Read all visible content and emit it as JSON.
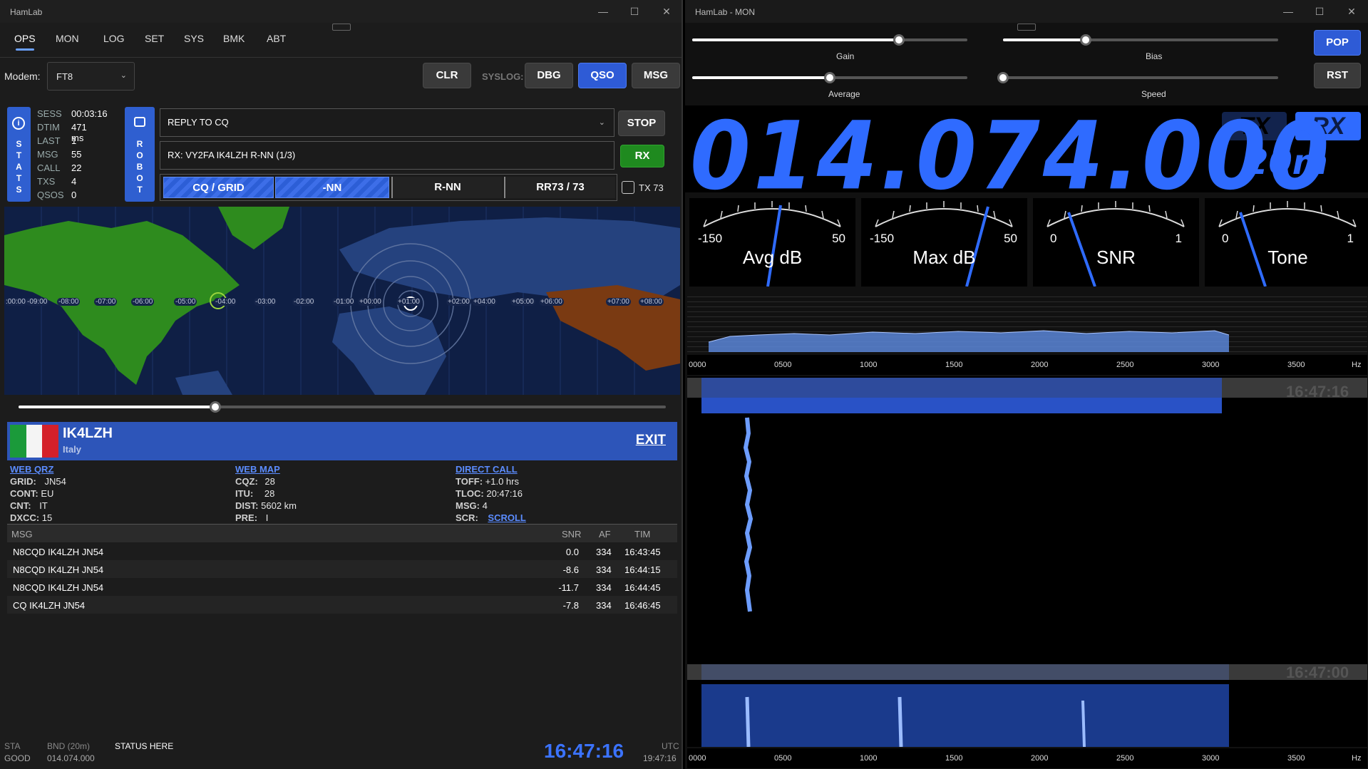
{
  "left": {
    "title": "HamLab",
    "tabs": [
      "OPS",
      "MON",
      "LOG",
      "SET",
      "SYS",
      "BMK",
      "ABT"
    ],
    "modem_label": "Modem:",
    "modem_value": "FT8",
    "buttons": {
      "clr": "CLR",
      "syslog": "SYSLOG:",
      "dbg": "DBG",
      "qso": "QSO",
      "msg": "MSG",
      "stop": "STOP",
      "rx": "RX"
    },
    "stats_side": "STATS",
    "robot_side": "ROBOT",
    "stats": [
      {
        "k": "SESS",
        "v": "00:03:16"
      },
      {
        "k": "DTIM",
        "v": "471 ms"
      },
      {
        "k": "LAST",
        "v": "1"
      },
      {
        "k": "MSG",
        "v": "55"
      },
      {
        "k": "CALL",
        "v": "22"
      },
      {
        "k": "TXS",
        "v": "4"
      },
      {
        "k": "QSOS",
        "v": "0"
      }
    ],
    "reply_select": "REPLY TO CQ",
    "rx_text": "RX: VY2FA IK4LZH R-NN (1/3)",
    "sequence": [
      "CQ / GRID",
      "-NN",
      "R-NN",
      "RR73 / 73"
    ],
    "tx73_label": "TX 73",
    "timezones": [
      ":00:00",
      "-09:00",
      "-08:00",
      "-07:00",
      "-06:00",
      "-05:00",
      "-04:00",
      "-03:00",
      "-02:00",
      "-01:00",
      "+00:00",
      "+01:00",
      "+02:00",
      "+04:00",
      "+05:00",
      "+06:00",
      "+07:00",
      "+08:00"
    ],
    "call": {
      "sign": "IK4LZH",
      "country": "Italy",
      "exit": "EXIT"
    },
    "info": {
      "col1": {
        "link": "WEB QRZ",
        "rows": [
          {
            "k": "GRID:",
            "v": "JN54"
          },
          {
            "k": "CONT:",
            "v": "EU"
          },
          {
            "k": "CNT:",
            "v": "IT"
          },
          {
            "k": "DXCC:",
            "v": "15"
          }
        ]
      },
      "col2": {
        "link": "WEB MAP",
        "rows": [
          {
            "k": "CQZ:",
            "v": "28"
          },
          {
            "k": "ITU:",
            "v": "28"
          },
          {
            "k": "DIST:",
            "v": "5602 km"
          },
          {
            "k": "PRE:",
            "v": "I"
          }
        ]
      },
      "col3": {
        "link": "DIRECT CALL",
        "rows": [
          {
            "k": "TOFF:",
            "v": "+1.0 hrs"
          },
          {
            "k": "TLOC:",
            "v": "20:47:16"
          },
          {
            "k": "MSG:",
            "v": "4"
          }
        ],
        "scr_k": "SCR:",
        "scr_link": "SCROLL"
      }
    },
    "table": {
      "headers": [
        "MSG",
        "SNR",
        "AF",
        "TIM"
      ],
      "rows": [
        [
          "N8CQD IK4LZH JN54",
          "0.0",
          "334",
          "16:43:45"
        ],
        [
          "N8CQD IK4LZH JN54",
          "-8.6",
          "334",
          "16:44:15"
        ],
        [
          "N8CQD IK4LZH JN54",
          "-11.7",
          "334",
          "16:44:45"
        ],
        [
          "CQ IK4LZH JN54",
          "-7.8",
          "334",
          "16:46:45"
        ]
      ]
    },
    "status": {
      "sta": "STA",
      "sta_val": "GOOD",
      "bnd": "BND (20m)",
      "bnd_val": "014.074.000",
      "msg": "STATUS HERE",
      "clock": "16:47:16",
      "utc": "UTC",
      "local": "19:47:16"
    }
  },
  "right": {
    "title": "HamLab - MON",
    "sliders": {
      "gain": "Gain",
      "bias": "Bias",
      "average": "Average",
      "speed": "Speed",
      "gain_level": 0.75,
      "bias_level": 0.3,
      "average_level": 0.5,
      "speed_level": 0.0
    },
    "buttons": {
      "pop": "POP",
      "rst": "RST",
      "tx": "TX",
      "rx": "RX"
    },
    "frequency": "014.074.000",
    "band": "20m",
    "meters": [
      {
        "title": "Avg dB",
        "min": "-150",
        "max": "50"
      },
      {
        "title": "Max dB",
        "min": "-150",
        "max": "50"
      },
      {
        "title": "SNR",
        "min": "0",
        "max": "1"
      },
      {
        "title": "Tone",
        "min": "0",
        "max": "1"
      }
    ],
    "axis_ticks": [
      "0000",
      "0500",
      "1000",
      "1500",
      "2000",
      "2500",
      "3000",
      "3500"
    ],
    "axis_unit": "Hz",
    "wf_times": [
      "16:47:16",
      "16:47:00"
    ]
  },
  "colors": {
    "accent": "#2f6bff",
    "panel_blue": "#2d55b9",
    "green": "#2fa52f",
    "map_land": "#2e8b1e"
  }
}
